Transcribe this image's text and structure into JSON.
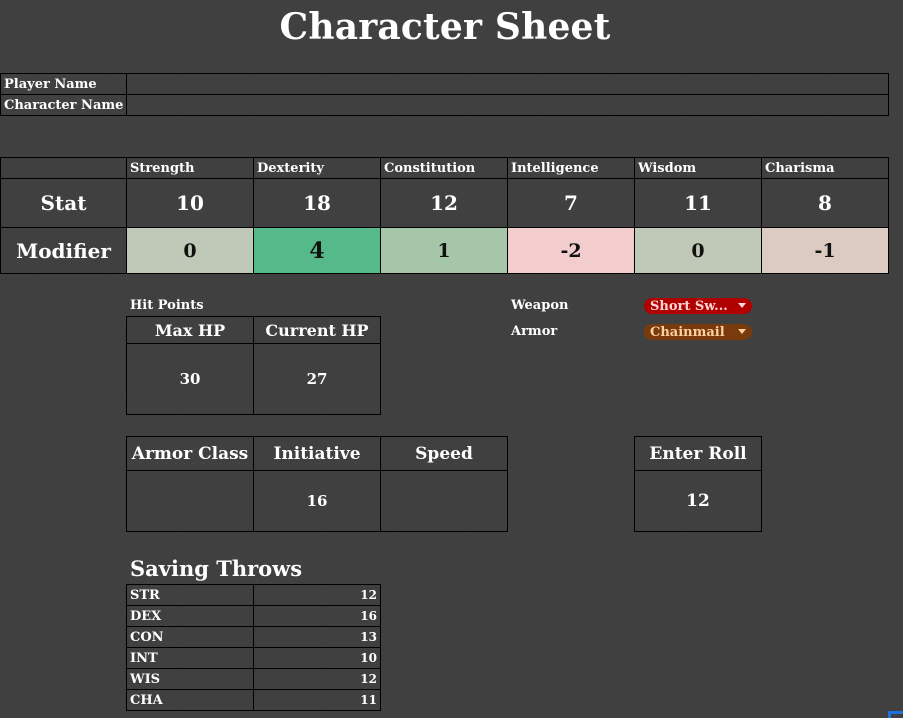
{
  "title": "Character Sheet",
  "identity": {
    "rows": [
      {
        "label": "Player Name",
        "value": ""
      },
      {
        "label": "Character Name",
        "value": ""
      }
    ]
  },
  "stats": {
    "row_labels": {
      "stat": "Stat",
      "modifier": "Modifier"
    },
    "abilities": [
      {
        "name": "Strength",
        "stat": "10",
        "modifier": "0",
        "modifier_color": "#c0c8b8"
      },
      {
        "name": "Dexterity",
        "stat": "18",
        "modifier": "4",
        "modifier_color": "#55b98a"
      },
      {
        "name": "Constitution",
        "stat": "12",
        "modifier": "1",
        "modifier_color": "#a6c6a9"
      },
      {
        "name": "Intelligence",
        "stat": "7",
        "modifier": "-2",
        "modifier_color": "#f3cdcd"
      },
      {
        "name": "Wisdom",
        "stat": "11",
        "modifier": "0",
        "modifier_color": "#c0c8b8"
      },
      {
        "name": "Charisma",
        "stat": "8",
        "modifier": "-1",
        "modifier_color": "#dccbc1"
      }
    ]
  },
  "hit_points": {
    "section_label": "Hit Points",
    "max_label": "Max HP",
    "current_label": "Current HP",
    "max_value": "30",
    "current_value": "27"
  },
  "equipment": {
    "weapon_label": "Weapon",
    "weapon_value": "Short Sw...",
    "weapon_color": "#b00000",
    "weapon_text_color": "#ffd6d6",
    "armor_label": "Armor",
    "armor_value": "Chainmail",
    "armor_color": "#7a3b0c",
    "armor_text_color": "#ffd0a0"
  },
  "combat": {
    "armor_class_label": "Armor Class",
    "armor_class_value": "",
    "initiative_label": "Initiative",
    "initiative_value": "16",
    "speed_label": "Speed",
    "speed_value": ""
  },
  "roll": {
    "label": "Enter Roll",
    "value": "12"
  },
  "saving_throws": {
    "title": "Saving Throws",
    "rows": [
      {
        "label": "STR",
        "value": "12"
      },
      {
        "label": "DEX",
        "value": "16"
      },
      {
        "label": "CON",
        "value": "13"
      },
      {
        "label": "INT",
        "value": "10"
      },
      {
        "label": "WIS",
        "value": "12"
      },
      {
        "label": "CHA",
        "value": "11"
      }
    ]
  }
}
